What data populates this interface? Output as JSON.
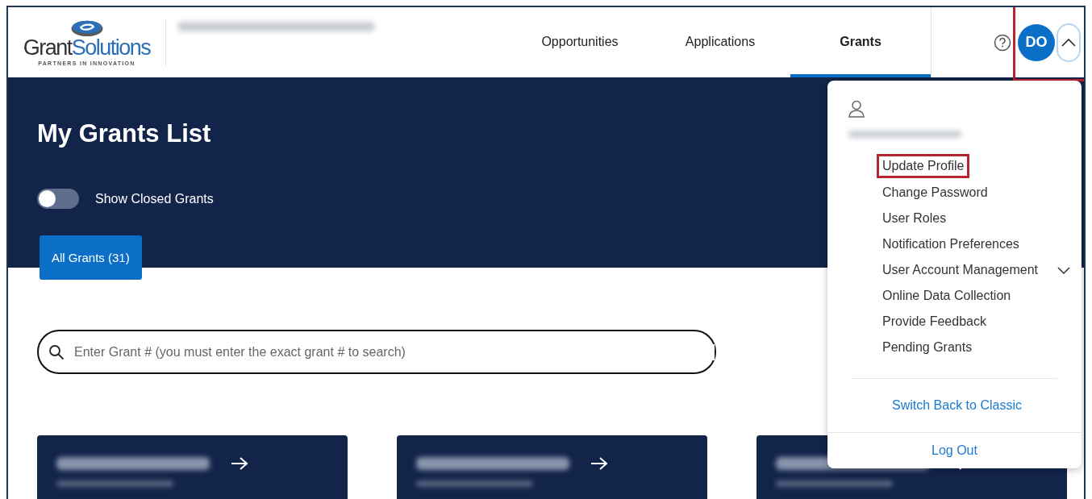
{
  "header": {
    "logo": {
      "name_dark": "Grant",
      "name_blue": "Solutions",
      "tagline": "PARTNERS IN INNOVATION"
    },
    "nav": [
      {
        "label": "Opportunities",
        "selected": false
      },
      {
        "label": "Applications",
        "selected": false
      },
      {
        "label": "Grants",
        "selected": true
      }
    ],
    "avatar": {
      "initials": "DO",
      "highlighted": true
    },
    "menu_toggle": {
      "expanded": true
    }
  },
  "user_menu": {
    "items": [
      {
        "label": "Update Profile",
        "highlighted": true,
        "kind": "link"
      },
      {
        "label": "Change Password",
        "highlighted": false,
        "kind": "link"
      },
      {
        "label": "User Roles",
        "highlighted": false,
        "kind": "link"
      },
      {
        "label": "Notification Preferences",
        "highlighted": false,
        "kind": "link"
      },
      {
        "label": "User Account Management",
        "highlighted": false,
        "kind": "submenu",
        "expanded": false
      },
      {
        "label": "Online Data Collection",
        "highlighted": false,
        "kind": "link"
      },
      {
        "label": "Provide Feedback",
        "highlighted": false,
        "kind": "link"
      },
      {
        "label": "Pending Grants",
        "highlighted": false,
        "kind": "link"
      }
    ],
    "switch_link": "Switch Back to Classic",
    "logout": "Log Out"
  },
  "page": {
    "title": "My Grants List",
    "toggle": {
      "label": "Show Closed Grants",
      "on": false
    },
    "tabs": [
      {
        "label": "All Grants (31)",
        "selected": true
      }
    ],
    "search": {
      "placeholder": "Enter Grant # (you must enter the exact grant # to search)"
    }
  },
  "grant_cards": [
    {
      "kind": "grant"
    },
    {
      "kind": "grant"
    },
    {
      "kind": "grant"
    }
  ]
}
